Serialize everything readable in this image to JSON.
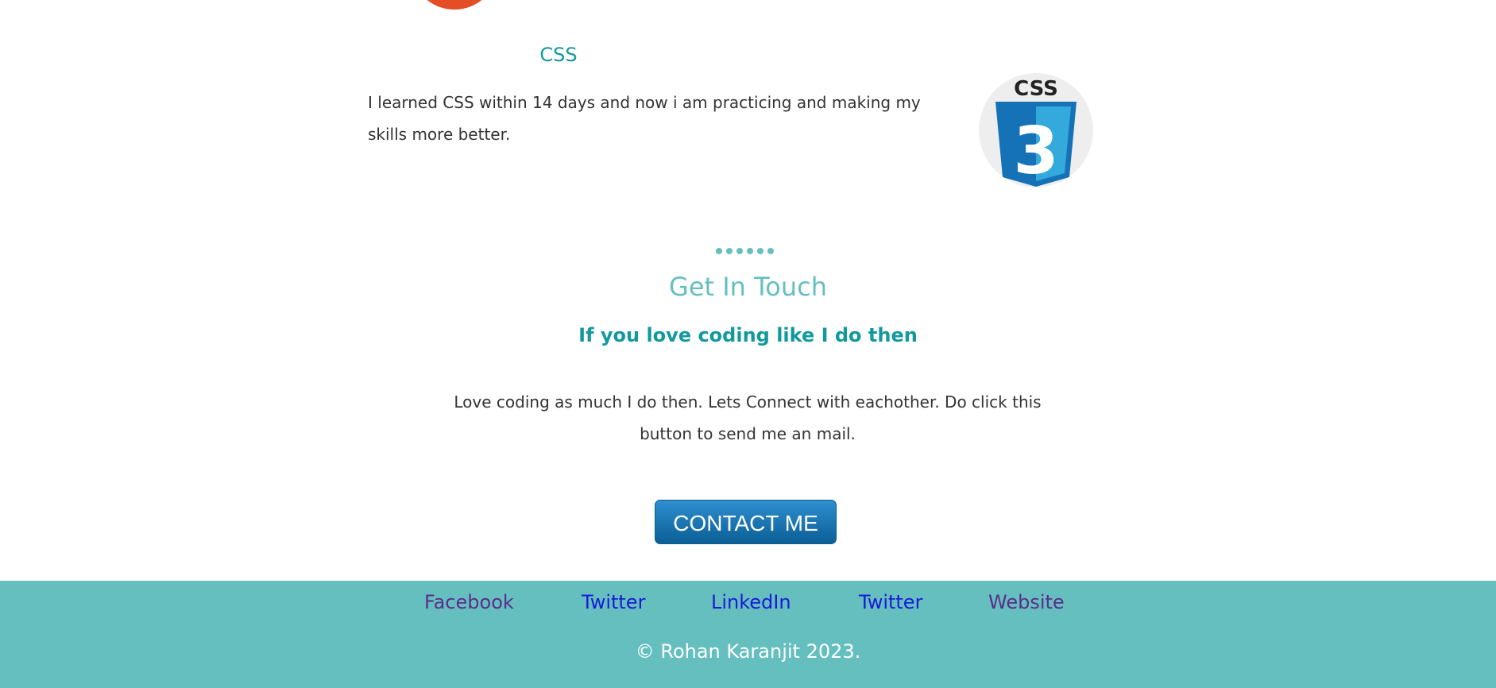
{
  "skill": {
    "title": "CSS",
    "description": "I learned CSS within 14 days and now i am practicing and making my skills more better.",
    "logo_text": "CSS",
    "logo_number": "3"
  },
  "contact": {
    "title": "Get In Touch",
    "subtitle": "If you love coding like I do then",
    "description": "Love coding as much I do then. Lets Connect with eachother. Do click this button to send me an mail.",
    "button_label": "CONTACT ME",
    "dots_count": 6
  },
  "footer": {
    "links": [
      {
        "label": "Facebook",
        "visited": true
      },
      {
        "label": "Twitter",
        "visited": false
      },
      {
        "label": "LinkedIn",
        "visited": false
      },
      {
        "label": "Twitter",
        "visited": false
      },
      {
        "label": "Website",
        "visited": true
      }
    ],
    "copyright": "© Rohan Karanjit 2023."
  },
  "colors": {
    "accent": "#66bfbf",
    "accent_dark": "#11999e",
    "css_blue": "#1572b6",
    "html_orange": "#e44d26"
  }
}
